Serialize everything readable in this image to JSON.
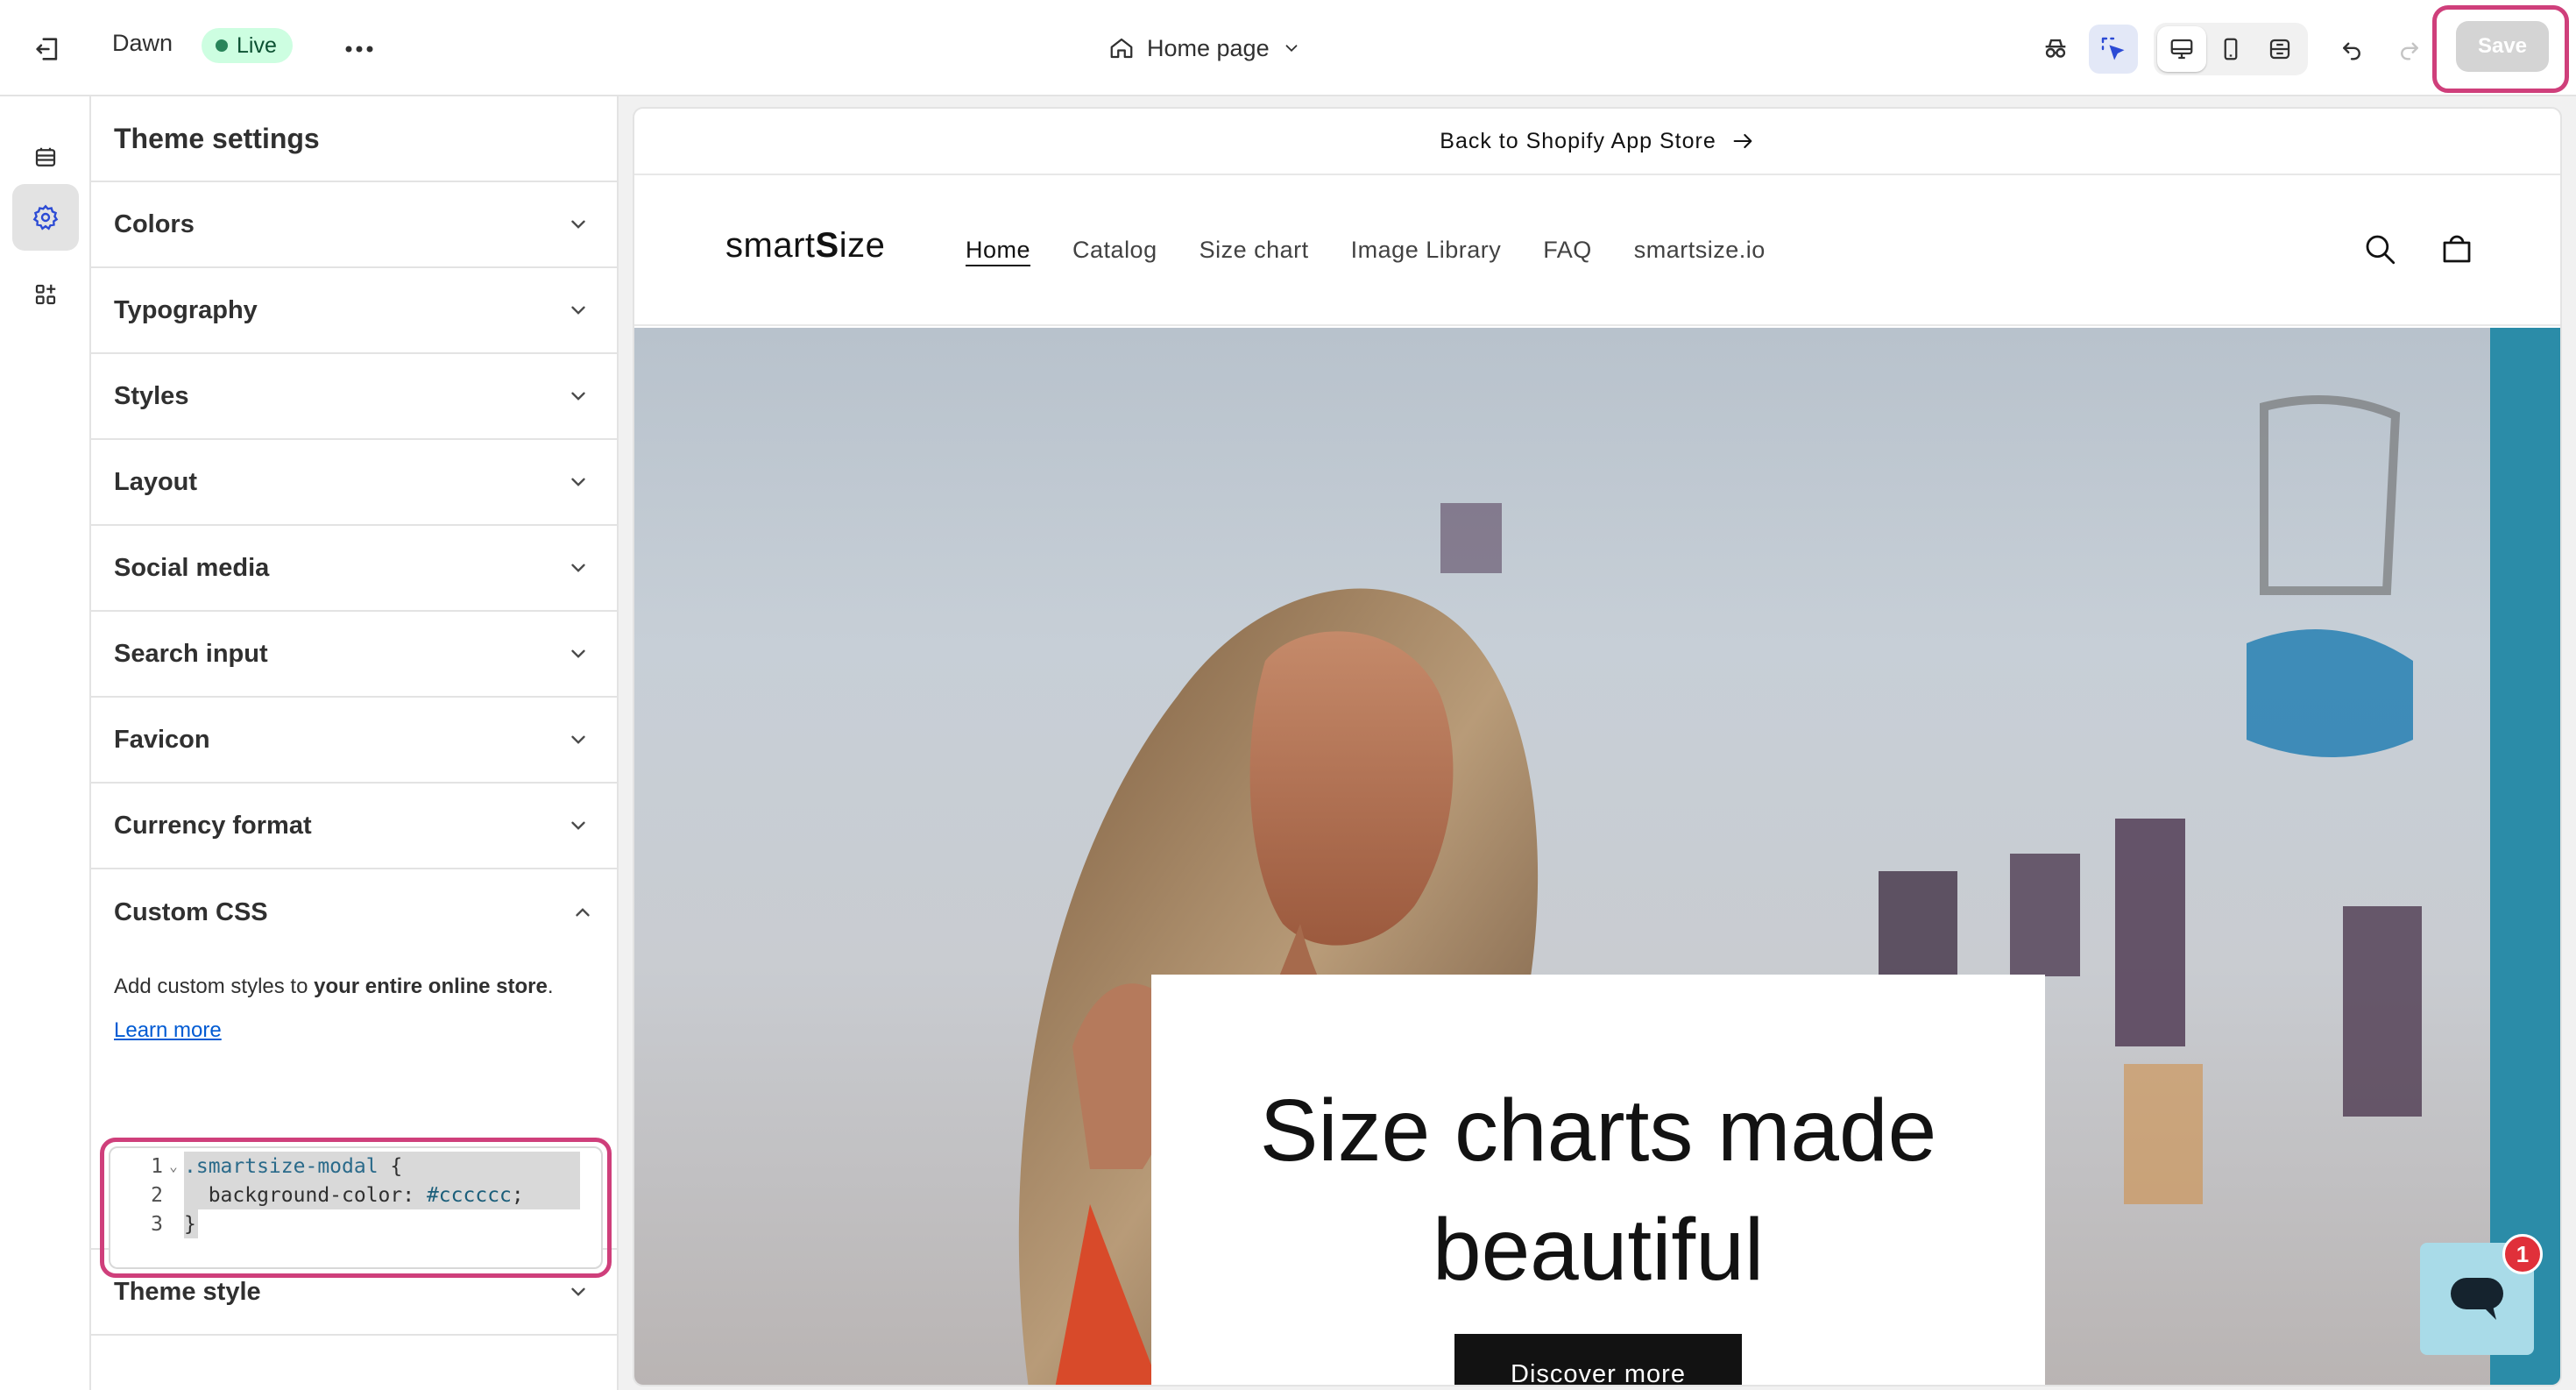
{
  "topbar": {
    "theme_name": "Dawn",
    "live_label": "Live",
    "page_selector": "Home page",
    "save_label": "Save"
  },
  "colors": {
    "accent_highlight": "#cf3f7b",
    "live_badge_bg": "#cdfee1",
    "link": "#005bd3"
  },
  "rail": {
    "items": [
      {
        "icon": "sections-icon"
      },
      {
        "icon": "settings-gear-icon"
      },
      {
        "icon": "apps-icon"
      }
    ]
  },
  "panel": {
    "title": "Theme settings",
    "sections": [
      {
        "label": "Colors"
      },
      {
        "label": "Typography"
      },
      {
        "label": "Styles"
      },
      {
        "label": "Layout"
      },
      {
        "label": "Social media"
      },
      {
        "label": "Search input"
      },
      {
        "label": "Favicon"
      },
      {
        "label": "Currency format"
      }
    ],
    "custom_css": {
      "label": "Custom CSS",
      "desc_prefix": "Add custom styles to ",
      "desc_bold": "your entire online store",
      "desc_suffix": ".",
      "learn_more": "Learn more",
      "code": {
        "line_numbers": [
          "1",
          "2",
          "3"
        ],
        "line1_selector": ".smartsize-modal",
        "line1_brace": " {",
        "line2_prop": "  background-color: ",
        "line2_value": "#cccccc",
        "line2_end": ";",
        "line3": "}"
      }
    },
    "theme_style": {
      "label": "Theme style"
    }
  },
  "preview": {
    "announcement": "Back to Shopify App Store",
    "logo_prefix": "smart",
    "logo_bold": "S",
    "logo_suffix": "ize",
    "nav": [
      "Home",
      "Catalog",
      "Size chart",
      "Image Library",
      "FAQ",
      "smartsize.io"
    ],
    "hero_heading_line1": "Size charts made",
    "hero_heading_line2": "beautiful",
    "hero_button": "Discover more"
  },
  "chat": {
    "badge_count": "1"
  }
}
